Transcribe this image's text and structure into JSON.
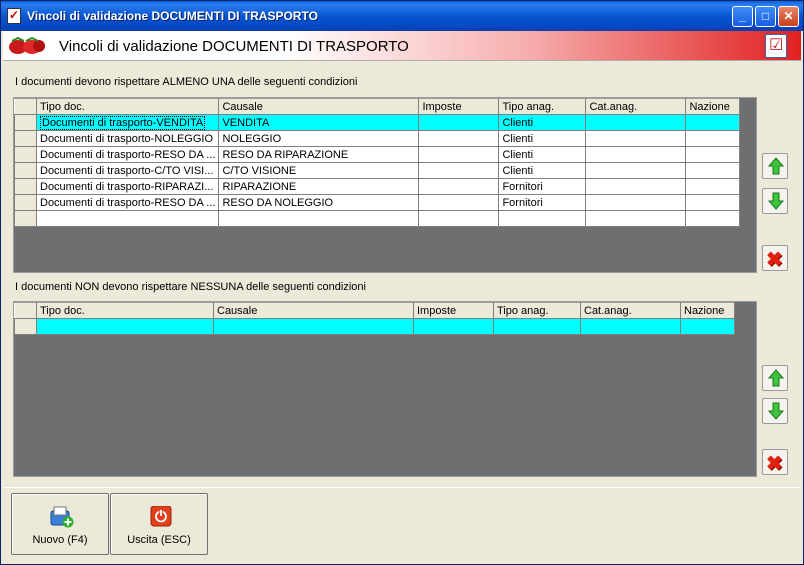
{
  "window": {
    "title": "Vincoli di validazione DOCUMENTI DI TRASPORTO",
    "controls": {
      "minimize": "_",
      "maximize": "□",
      "close": "✕"
    }
  },
  "banner": {
    "title": "Vincoli di validazione DOCUMENTI DI TRASPORTO",
    "left_icon": "strawberries-icon",
    "right_icon": "checklist-icon"
  },
  "colors": {
    "selected_row": "#00ffff",
    "grid_background": "#6f6f6f",
    "window_face": "#ece9d8",
    "banner_accent": "#e02020"
  },
  "columns": [
    "Tipo doc.",
    "Causale",
    "Imposte",
    "Tipo anag.",
    "Cat.anag.",
    "Nazione"
  ],
  "include_section": {
    "label": "I documenti devono rispettare ALMENO UNA delle seguenti condizioni",
    "rows": [
      {
        "tipo_doc": "Documenti di trasporto-VENDITA",
        "causale": "VENDITA",
        "imposte": "",
        "tipo_anag": "Clienti",
        "cat_anag": "",
        "nazione": ""
      },
      {
        "tipo_doc": "Documenti di trasporto-NOLEGGIO",
        "causale": "NOLEGGIO",
        "imposte": "",
        "tipo_anag": "Clienti",
        "cat_anag": "",
        "nazione": ""
      },
      {
        "tipo_doc": "Documenti di trasporto-RESO DA ...",
        "causale": "RESO DA RIPARAZIONE",
        "imposte": "",
        "tipo_anag": "Clienti",
        "cat_anag": "",
        "nazione": ""
      },
      {
        "tipo_doc": "Documenti di trasporto-C/TO VISI...",
        "causale": "C/TO VISIONE",
        "imposte": "",
        "tipo_anag": "Clienti",
        "cat_anag": "",
        "nazione": ""
      },
      {
        "tipo_doc": "Documenti di trasporto-RIPARAZI...",
        "causale": "RIPARAZIONE",
        "imposte": "",
        "tipo_anag": "Fornitori",
        "cat_anag": "",
        "nazione": ""
      },
      {
        "tipo_doc": "Documenti di trasporto-RESO DA ...",
        "causale": "RESO DA NOLEGGIO",
        "imposte": "",
        "tipo_anag": "Fornitori",
        "cat_anag": "",
        "nazione": ""
      },
      {
        "tipo_doc": "",
        "causale": "",
        "imposte": "",
        "tipo_anag": "",
        "cat_anag": "",
        "nazione": ""
      }
    ]
  },
  "exclude_section": {
    "label": "I documenti NON devono rispettare NESSUNA delle seguenti condizioni",
    "rows": [
      {
        "tipo_doc": "",
        "causale": "",
        "imposte": "",
        "tipo_anag": "",
        "cat_anag": "",
        "nazione": ""
      }
    ]
  },
  "side_buttons": {
    "move_up": "arrow-up-icon",
    "move_down": "arrow-down-icon",
    "delete": "delete-x-icon"
  },
  "footer": {
    "new_label": "Nuovo (F4)",
    "exit_label": "Uscita (ESC)"
  }
}
